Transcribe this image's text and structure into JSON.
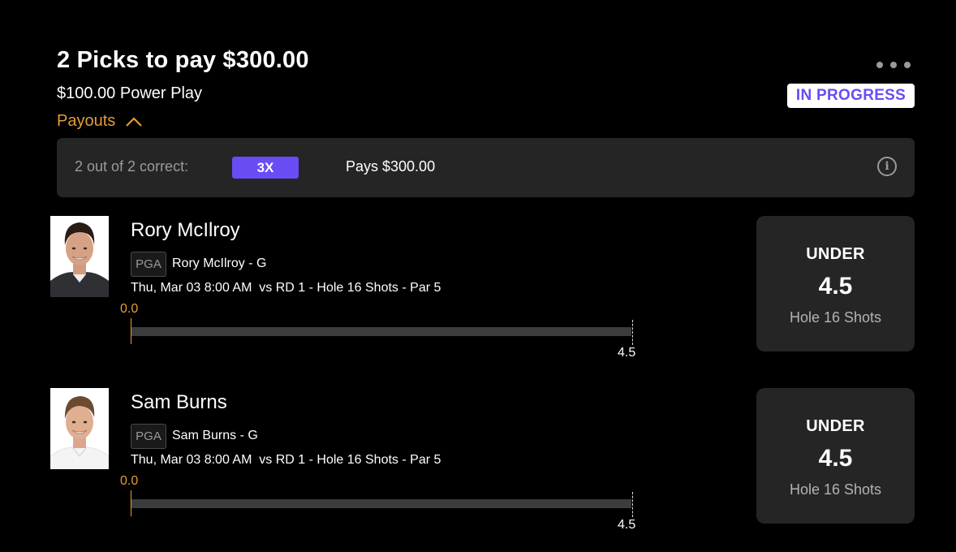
{
  "header": {
    "title": "2 Picks to pay $300.00",
    "subtitle": "$100.00 Power Play",
    "status": "IN PROGRESS",
    "more_icon": "more-horizontal-icon"
  },
  "payouts": {
    "toggle_label": "Payouts",
    "toggle_icon": "chevron-up-icon",
    "correct_label": "2 out of 2 correct:",
    "multiplier": "3X",
    "pays": "Pays $300.00",
    "info_icon": "info-icon",
    "info_glyph": "i"
  },
  "picks": [
    {
      "player": "Rory McIlroy",
      "league": "PGA",
      "team": "Rory McIlroy - G",
      "game": "Thu, Mar 03 8:00 AM  vs RD 1 - Hole 16 Shots - Par 5",
      "current_value": "0.0",
      "line_label": "4.5",
      "direction": "UNDER",
      "line": "4.5",
      "stat": "Hole 16 Shots"
    },
    {
      "player": "Sam Burns",
      "league": "PGA",
      "team": "Sam Burns - G",
      "game": "Thu, Mar 03 8:00 AM  vs RD 1 - Hole 16 Shots - Par 5",
      "current_value": "0.0",
      "line_label": "4.5",
      "direction": "UNDER",
      "line": "4.5",
      "stat": "Hole 16 Shots"
    }
  ],
  "colors": {
    "accent_orange": "#e39d34",
    "accent_purple": "#6a4cf5",
    "panel": "#252525",
    "background": "#000000"
  }
}
